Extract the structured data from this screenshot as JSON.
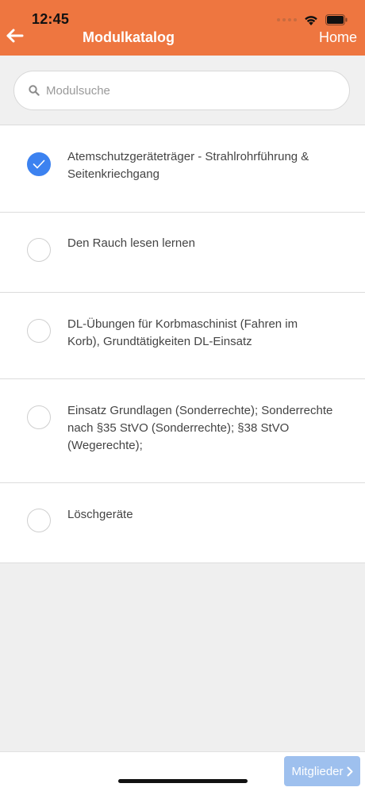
{
  "status_bar": {
    "time": "12:45"
  },
  "header": {
    "title": "Modulkatalog",
    "home_label": "Home"
  },
  "search": {
    "placeholder": "Modulsuche"
  },
  "modules": [
    {
      "label": "Atemschutzgeräteträger - Strahlrohrführung & Seitenkriechgang",
      "checked": true
    },
    {
      "label": "Den Rauch lesen lernen",
      "checked": false
    },
    {
      "label": "DL-Übungen für Korbmaschinist (Fahren im Korb), Grundtätigkeiten DL-Einsatz",
      "checked": false
    },
    {
      "label": "Einsatz Grundlagen (Sonderrechte); Sonderrechte nach §35 StVO (Sonderrechte); §38 StVO (Wegerechte);",
      "checked": false
    },
    {
      "label": "Löschgeräte",
      "checked": false
    }
  ],
  "footer": {
    "mitglieder_label": "Mitglieder"
  },
  "colors": {
    "accent": "#ee7640",
    "checked": "#3c82f0",
    "button": "#9ec0ee"
  }
}
